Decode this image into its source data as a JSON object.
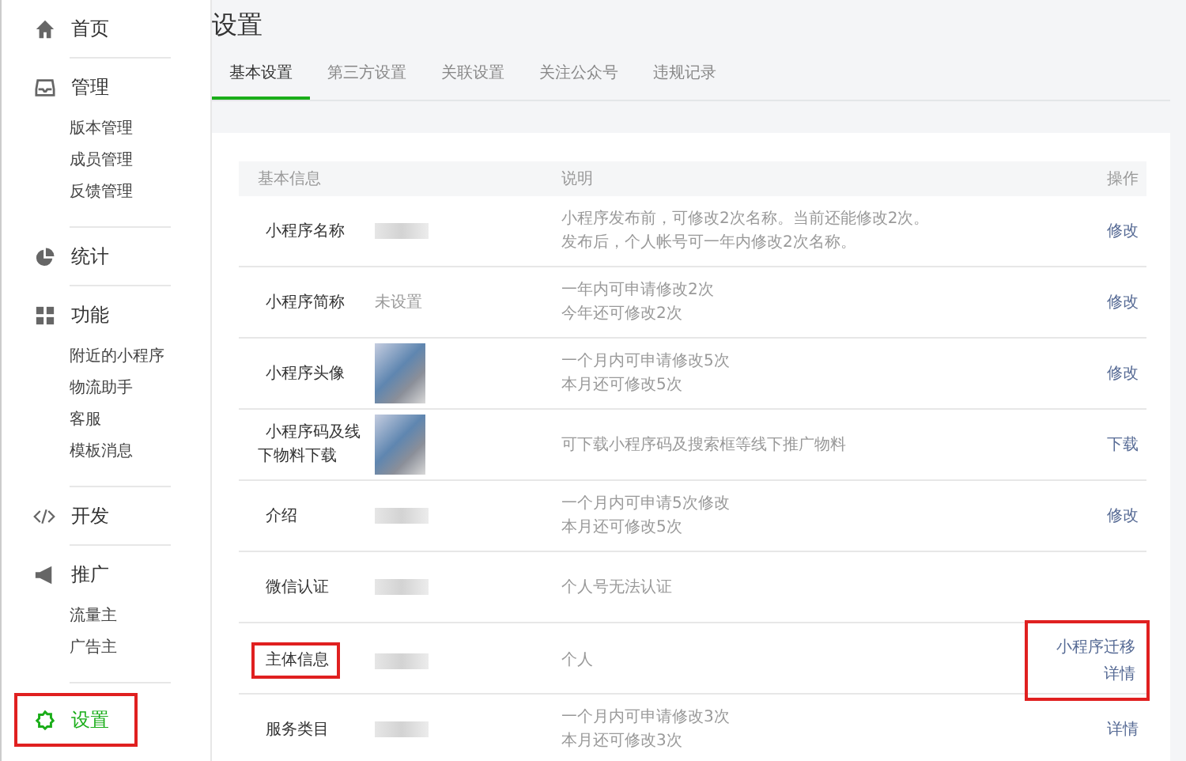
{
  "sidebar": {
    "groups": [
      {
        "label": "首页",
        "selected": false,
        "highlighted": false
      },
      {
        "label": "管理",
        "selected": false,
        "highlighted": false,
        "items": [
          "版本管理",
          "成员管理",
          "反馈管理"
        ]
      },
      {
        "label": "统计",
        "selected": false,
        "highlighted": false
      },
      {
        "label": "功能",
        "selected": false,
        "highlighted": false,
        "items": [
          "附近的小程序",
          "物流助手",
          "客服",
          "模板消息"
        ]
      },
      {
        "label": "开发",
        "selected": false,
        "highlighted": false
      },
      {
        "label": "推广",
        "selected": false,
        "highlighted": false,
        "items": [
          "流量主",
          "广告主"
        ]
      },
      {
        "label": "设置",
        "selected": true,
        "highlighted": true
      }
    ]
  },
  "page": {
    "title": "设置",
    "tabs": [
      {
        "label": "基本设置",
        "selected": true
      },
      {
        "label": "第三方设置",
        "selected": false
      },
      {
        "label": "关联设置",
        "selected": false
      },
      {
        "label": "关注公众号",
        "selected": false
      },
      {
        "label": "违规记录",
        "selected": false
      }
    ],
    "table": {
      "columns": [
        "基本信息",
        "说明",
        "操作"
      ],
      "rows": [
        {
          "kind": "blurred",
          "label": "小程序名称",
          "label_highlighted": false,
          "description": [
            "小程序发布前，可修改2次名称。当前还能修改2次。",
            "发布后，个人帐号可一年内修改2次名称。"
          ],
          "actions": [
            "修改"
          ],
          "actions_highlighted": false
        },
        {
          "kind": "text",
          "label": "小程序简称",
          "label_highlighted": false,
          "value": "未设置",
          "description": [
            "一年内可申请修改2次",
            "今年还可修改2次"
          ],
          "actions": [
            "修改"
          ],
          "actions_highlighted": false
        },
        {
          "kind": "image",
          "label": "小程序头像",
          "label_highlighted": false,
          "description": [
            "一个月内可申请修改5次",
            "本月还可修改5次"
          ],
          "actions": [
            "修改"
          ],
          "actions_highlighted": false
        },
        {
          "kind": "image",
          "label": "小程序码及线下物料下载",
          "label_highlighted": false,
          "description": [
            "可下载小程序码及搜索框等线下推广物料"
          ],
          "actions": [
            "下载"
          ],
          "actions_highlighted": false
        },
        {
          "kind": "blurred",
          "label": "介绍",
          "label_highlighted": false,
          "description": [
            "一个月内可申请5次修改",
            "本月还可修改5次"
          ],
          "actions": [
            "修改"
          ],
          "actions_highlighted": false
        },
        {
          "kind": "blurred",
          "label": "微信认证",
          "label_highlighted": false,
          "description": [
            "个人号无法认证"
          ],
          "actions_highlighted": false
        },
        {
          "kind": "blurred",
          "label": "主体信息",
          "label_highlighted": true,
          "description": [
            "个人"
          ],
          "actions": [
            "小程序迁移",
            "详情"
          ],
          "actions_highlighted": true
        },
        {
          "kind": "blurred",
          "label": "服务类目",
          "label_highlighted": false,
          "description": [
            "一个月内可申请修改3次",
            "本月还可修改3次"
          ],
          "actions": [
            "详情"
          ],
          "actions_highlighted": false
        }
      ]
    }
  }
}
